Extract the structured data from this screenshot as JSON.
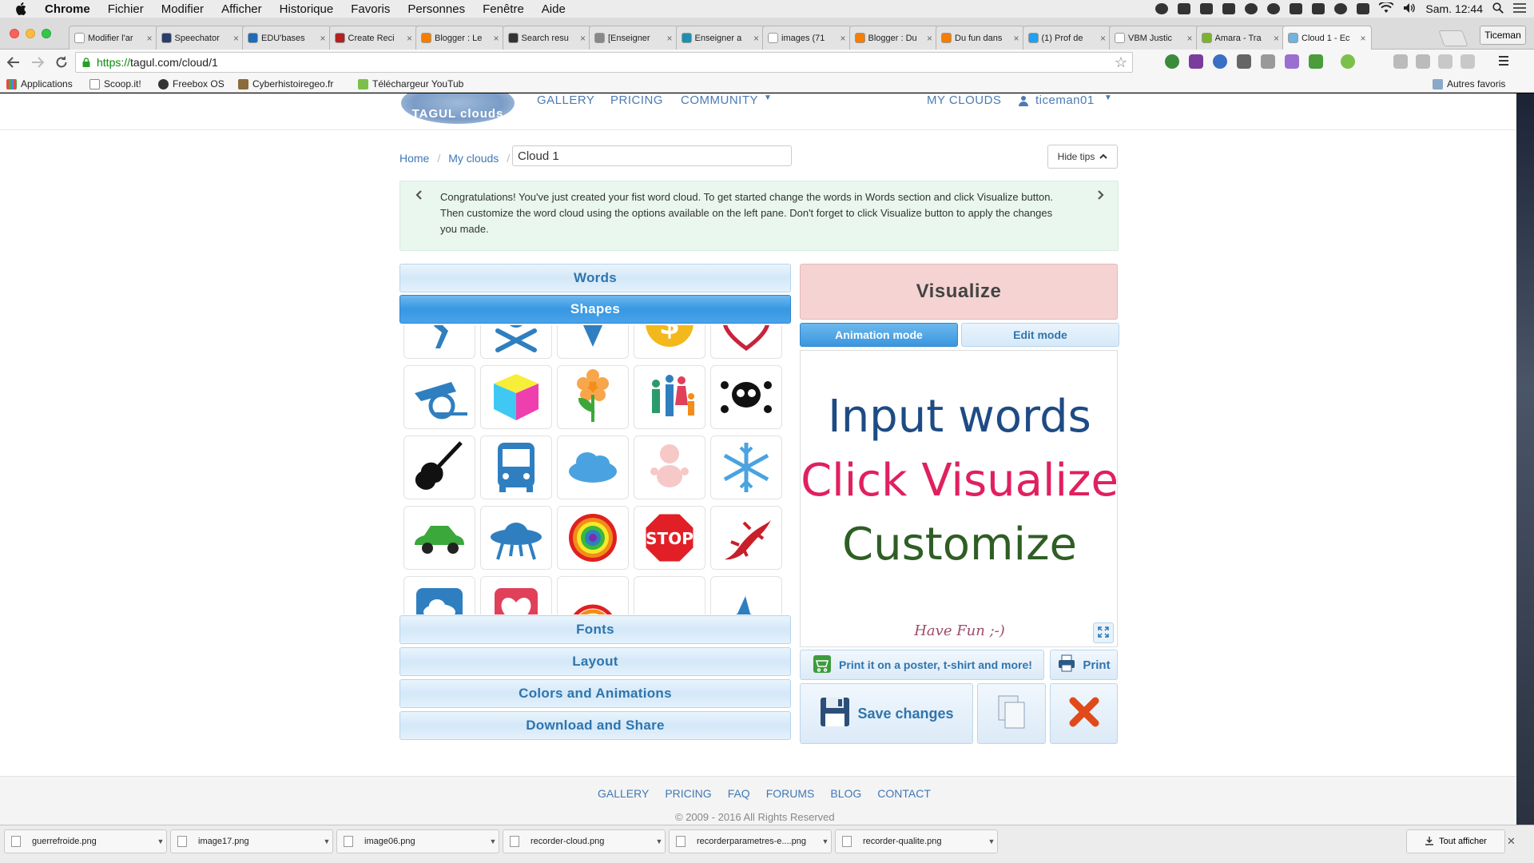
{
  "menubar": {
    "app": "Chrome",
    "items": [
      "Fichier",
      "Modifier",
      "Afficher",
      "Historique",
      "Favoris",
      "Personnes",
      "Fenêtre",
      "Aide"
    ],
    "clock": "Sam. 12:44"
  },
  "tabs": [
    {
      "label": "Modifier l'ar",
      "favicon_color": "#ffffff"
    },
    {
      "label": "Speechator",
      "favicon_color": "#2a3d6b"
    },
    {
      "label": "EDU'bases",
      "favicon_color": "#1e6bb8"
    },
    {
      "label": "Create Reci",
      "favicon_color": "#b22222"
    },
    {
      "label": "Blogger : Le",
      "favicon_color": "#f57d00"
    },
    {
      "label": "Search resu",
      "favicon_color": "#333333"
    },
    {
      "label": "[Enseigner",
      "favicon_color": "#888888"
    },
    {
      "label": "Enseigner a",
      "favicon_color": "#1d8fb0"
    },
    {
      "label": "images (71",
      "favicon_color": "#ffffff"
    },
    {
      "label": "Blogger : Du",
      "favicon_color": "#f57d00"
    },
    {
      "label": "Du fun dans",
      "favicon_color": "#f57d00"
    },
    {
      "label": "(1) Prof de",
      "favicon_color": "#1da1f2"
    },
    {
      "label": "VBM Justic",
      "favicon_color": "#ffffff"
    },
    {
      "label": "Amara - Tra",
      "favicon_color": "#7bb32e"
    },
    {
      "label": "Cloud 1 - Ec",
      "favicon_color": "#6fb3e0"
    }
  ],
  "profile_name": "Ticeman",
  "address": {
    "scheme": "https://",
    "rest": "tagul.com/cloud/1"
  },
  "bookmarks": [
    "Applications",
    "Scoop.it!",
    "Freebox OS",
    "Cyberhistoiregeo.fr",
    "Téléchargeur YouTub"
  ],
  "other_bookmarks": "Autres favoris",
  "site": {
    "logo": "TAGUL clouds",
    "nav": [
      "GALLERY",
      "PRICING",
      "COMMUNITY"
    ],
    "nav_right": "MY CLOUDS",
    "user": "ticeman01"
  },
  "breadcrumb": {
    "home": "Home",
    "clouds": "My clouds"
  },
  "cloud_name": "Cloud 1",
  "hide_tips": "Hide tips",
  "tip_text": "Congratulations! You've just created your fist word cloud. To get started change the words in Words section and click Visualize button. Then customize the word cloud using the options available on the left pane. Don't forget to click Visualize button to apply the changes you made.",
  "sections": {
    "words": "Words",
    "shapes": "Shapes",
    "fonts": "Fonts",
    "layout": "Layout",
    "colors": "Colors and Animations",
    "download": "Download and Share"
  },
  "shapes": [
    "runner",
    "crossbones",
    "star",
    "dollar-coin",
    "heart",
    "cannon",
    "cube",
    "flower",
    "family",
    "skull",
    "guitar",
    "bus",
    "cloud",
    "baby",
    "snowflake",
    "car",
    "ufo",
    "target",
    "stop-sign",
    "lizard",
    "cloud-square",
    "heart-square",
    "rainbow",
    "bat",
    "airplane"
  ],
  "visualize": "Visualize",
  "modes": {
    "animation": "Animation mode",
    "edit": "Edit mode"
  },
  "canvas": {
    "lines": [
      {
        "text": "Input words",
        "color": "#1e4b84"
      },
      {
        "text": "Click Visualize",
        "color": "#e0205f"
      },
      {
        "text": "Customize",
        "color": "#2f5e24"
      }
    ],
    "have_fun": "Have Fun ;-)"
  },
  "actions": {
    "poster": "Print it on a poster, t-shirt and more!",
    "print": "Print",
    "save": "Save changes"
  },
  "footer": {
    "links": [
      "GALLERY",
      "PRICING",
      "FAQ",
      "FORUMS",
      "BLOG",
      "CONTACT"
    ],
    "copyright": "© 2009 - 2016 All Rights Reserved"
  },
  "downloads": [
    "guerrefroide.png",
    "image17.png",
    "image06.png",
    "recorder-cloud.png",
    "recorderparametres-e....png",
    "recorder-qualite.png"
  ],
  "show_all": "Tout afficher"
}
